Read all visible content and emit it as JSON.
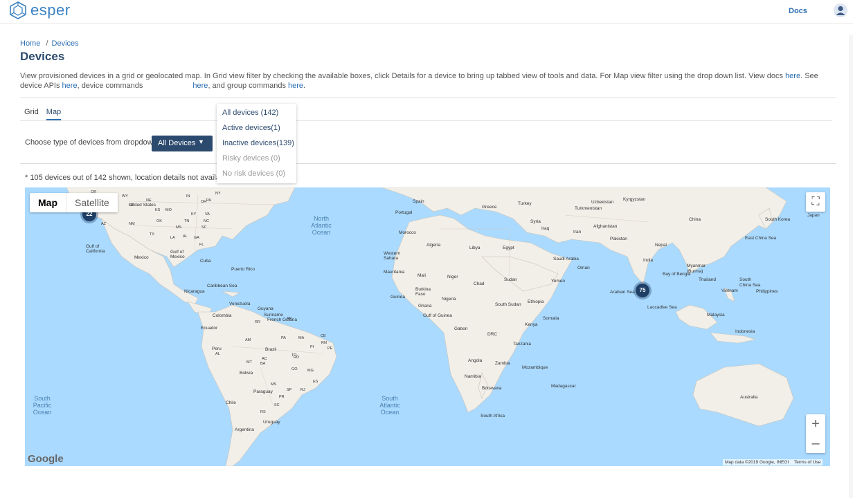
{
  "header": {
    "brand": "esper",
    "docs_label": "Docs",
    "accent_color": "#3b82c4"
  },
  "breadcrumb": {
    "home": "Home",
    "separator": "/",
    "current": "Devices"
  },
  "page_title": "Devices",
  "description": {
    "part1": "View provisioned devices in a grid or geolocated map. In Grid view filter by checking the available boxes, click Details for a device to bring up tabbed view of tools and data. For Map view filter using the drop down list. View docs ",
    "link1": "here",
    "part2": ". See device APIs ",
    "link2": "here",
    "part3": ", device commands ",
    "link3": "here",
    "part4": ", and group commands ",
    "link4": "here",
    "part5": "."
  },
  "tabs": [
    {
      "label": "Grid",
      "active": false
    },
    {
      "label": "Map",
      "active": true
    }
  ],
  "filter": {
    "label": "Choose type of devices from dropdown",
    "selected": "All Devices",
    "options": [
      {
        "label": "All devices (142)",
        "enabled": true
      },
      {
        "label": "Active devices(1)",
        "enabled": true
      },
      {
        "label": "Inactive devices(139)",
        "enabled": true
      },
      {
        "label": "Risky devices (0)",
        "enabled": false
      },
      {
        "label": "No risk devices (0)",
        "enabled": false
      }
    ]
  },
  "note": "* 105 devices out of 142 shown, location details not available",
  "map": {
    "type_buttons": {
      "map": "Map",
      "satellite": "Satellite"
    },
    "clusters": [
      {
        "count": "22"
      },
      {
        "count": "75"
      }
    ],
    "google_logo": "Google",
    "attribution": "Map data ©2019 Google, INEGI",
    "terms": "Terms of Use",
    "oceans": {
      "north_atlantic": "North\nAtlantic\nOcean",
      "south_atlantic": "South\nAtlantic\nOcean",
      "south_pacific": "South\nPacific\nOcean"
    },
    "labels": {
      "spain": "Spain",
      "portugal": "Portugal",
      "greece": "Greece",
      "turkey": "Turkey",
      "uzbekistan": "Uzbekistan",
      "kyrgyzstan": "Kyrgyzstan",
      "turkmenistan": "Turkmenistan",
      "china": "China",
      "south_korea": "South Korea",
      "japan": "Japan",
      "afghanistan": "Afghanistan",
      "syria": "Syria",
      "iraq": "Iraq",
      "iran": "Iran",
      "pakistan": "Pakistan",
      "nepal": "Nepal",
      "india": "India",
      "myanmar": "Myanmar\n(Burma)",
      "thailand": "Thailand",
      "vietnam": "Vietnam",
      "south_china_sea": "South\nChina Sea",
      "east_china_sea": "East China Sea",
      "philippines": "Philippines",
      "malaysia": "Malaysia",
      "indonesia": "Indonesia",
      "bay_bengal": "Bay of Bengal",
      "laccadive": "Laccadive Sea",
      "arabian": "Arabian Sea",
      "morocco": "Morocco",
      "algeria": "Algeria",
      "libya": "Libya",
      "egypt": "Egypt",
      "western_sahara": "Western\nSahara",
      "mauritania": "Mauritania",
      "mali": "Mali",
      "niger": "Niger",
      "chad": "Chad",
      "sudan": "Sudan",
      "saudi": "Saudi Arabia",
      "oman": "Oman",
      "yemen": "Yemen",
      "burkina": "Burkina\nFaso",
      "guinea": "Guinea",
      "ghana": "Ghana",
      "nigeria": "Nigeria",
      "ethiopia": "Ethiopia",
      "south_sudan": "South Sudan",
      "somalia": "Somalia",
      "gulf_guinea": "Gulf of Guinea",
      "gabon": "Gabon",
      "drc": "DRC",
      "kenya": "Kenya",
      "tanzania": "Tanzania",
      "angola": "Angola",
      "zambia": "Zambia",
      "mozambique": "Mozambique",
      "namibia": "Namibia",
      "botswana": "Botswana",
      "south_africa": "South Africa",
      "madagascar": "Madagascar",
      "australia": "Australia",
      "united_states": "United States",
      "mexico": "Mexico",
      "gulf_mexico": "Gulf of\nMexico",
      "gulf_california": "Gulf of\nCalifornia",
      "cuba": "Cuba",
      "puerto_rico": "Puerto Rico",
      "caribbean": "Caribbean Sea",
      "nicaragua": "Nicaragua",
      "venezuela": "Venezuela",
      "colombia": "Colombia",
      "guyana": "Guyana",
      "suriname": "Suriname",
      "french_guiana": "French Guiana",
      "ecuador": "Ecuador",
      "peru": "Peru",
      "brazil": "Brazil",
      "bolivia": "Bolivia",
      "paraguay": "Paraguay",
      "chile": "Chile",
      "argentina": "Argentina",
      "uruguay": "Uruguay"
    },
    "state_codes": [
      "OR",
      "WY",
      "NE",
      "ID",
      "SD",
      "IN",
      "OH",
      "PA",
      "NY",
      "UT",
      "KS",
      "MO",
      "KY",
      "VA",
      "AZ",
      "NM",
      "OK",
      "TN",
      "NC",
      "MS",
      "SC",
      "TX",
      "LA",
      "AL",
      "GA",
      "FL",
      "RR",
      "AP",
      "AM",
      "PA",
      "MA",
      "CE",
      "RN",
      "PI",
      "PE",
      "TO",
      "AL",
      "AC",
      "RO",
      "MT",
      "BA",
      "GO",
      "MG",
      "ES",
      "MS",
      "SP",
      "RJ",
      "PR",
      "SC",
      "RS"
    ]
  }
}
